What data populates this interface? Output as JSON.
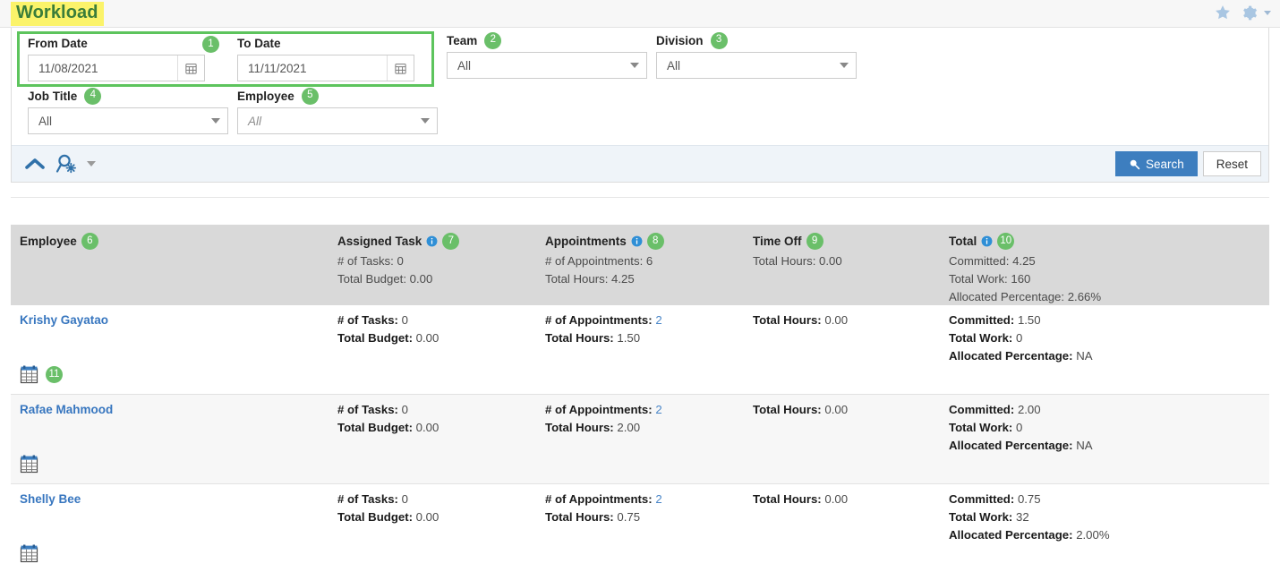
{
  "header": {
    "title": "Workload",
    "icons": [
      {
        "name": "favorite-star-icon"
      },
      {
        "name": "settings-gear-icon"
      }
    ]
  },
  "filters": {
    "from_date": {
      "label": "From Date",
      "badge": "1",
      "value": "11/08/2021",
      "icon": "calendar-icon"
    },
    "to_date": {
      "label": "To Date",
      "value": "11/11/2021",
      "icon": "calendar-icon"
    },
    "team": {
      "label": "Team",
      "badge": "2",
      "value": "All"
    },
    "division": {
      "label": "Division",
      "badge": "3",
      "value": "All"
    },
    "job_title": {
      "label": "Job Title",
      "badge": "4",
      "value": "All"
    },
    "employee": {
      "label": "Employee",
      "badge": "5",
      "value": "All",
      "is_placeholder": true
    }
  },
  "actions": {
    "collapse_icon": "chevron-up-icon",
    "advanced_search_icon": "search-settings-icon",
    "search_label": "Search",
    "reset_label": "Reset"
  },
  "grid": {
    "columns": [
      {
        "title": "Employee",
        "badge": "6",
        "info": false
      },
      {
        "title": "Assigned Task",
        "badge": "7",
        "info": true
      },
      {
        "title": "Appointments",
        "badge": "8",
        "info": true
      },
      {
        "title": "Time Off",
        "badge": "9",
        "info": false
      },
      {
        "title": "Total",
        "badge": "10",
        "info": true
      }
    ],
    "summary": {
      "task": [
        {
          "key": "# of Tasks:",
          "value": "0"
        },
        {
          "key": "Total Budget:",
          "value": "0.00"
        }
      ],
      "appointments": [
        {
          "key": "# of Appointments:",
          "value": "6"
        },
        {
          "key": "Total Hours:",
          "value": "4.25"
        }
      ],
      "time_off": [
        {
          "key": "Total Hours:",
          "value": "0.00"
        }
      ],
      "total": [
        {
          "key": "Committed:",
          "value": "4.25"
        },
        {
          "key": "Total Work:",
          "value": "160"
        },
        {
          "key": "Allocated Percentage:",
          "value": "2.66%"
        }
      ]
    },
    "row_calendar_icon": "calendar-icon",
    "row_calendar_badge": "11",
    "rows": [
      {
        "employee": "Krishy Gayatao",
        "task": [
          {
            "key": "# of Tasks:",
            "value": "0",
            "link": false
          },
          {
            "key": "Total Budget:",
            "value": "0.00",
            "link": false
          }
        ],
        "appointments": [
          {
            "key": "# of Appointments:",
            "value": "2",
            "link": true
          },
          {
            "key": "Total Hours:",
            "value": "1.50",
            "link": false
          }
        ],
        "time_off": [
          {
            "key": "Total Hours:",
            "value": "0.00",
            "link": false
          }
        ],
        "total": [
          {
            "key": "Committed:",
            "value": "1.50",
            "link": false
          },
          {
            "key": "Total Work:",
            "value": "0",
            "link": false
          },
          {
            "key": "Allocated Percentage:",
            "value": "NA",
            "link": false
          }
        ]
      },
      {
        "employee": "Rafae Mahmood",
        "task": [
          {
            "key": "# of Tasks:",
            "value": "0",
            "link": false
          },
          {
            "key": "Total Budget:",
            "value": "0.00",
            "link": false
          }
        ],
        "appointments": [
          {
            "key": "# of Appointments:",
            "value": "2",
            "link": true
          },
          {
            "key": "Total Hours:",
            "value": "2.00",
            "link": false
          }
        ],
        "time_off": [
          {
            "key": "Total Hours:",
            "value": "0.00",
            "link": false
          }
        ],
        "total": [
          {
            "key": "Committed:",
            "value": "2.00",
            "link": false
          },
          {
            "key": "Total Work:",
            "value": "0",
            "link": false
          },
          {
            "key": "Allocated Percentage:",
            "value": "NA",
            "link": false
          }
        ]
      },
      {
        "employee": "Shelly Bee",
        "task": [
          {
            "key": "# of Tasks:",
            "value": "0",
            "link": false
          },
          {
            "key": "Total Budget:",
            "value": "0.00",
            "link": false
          }
        ],
        "appointments": [
          {
            "key": "# of Appointments:",
            "value": "2",
            "link": true
          },
          {
            "key": "Total Hours:",
            "value": "0.75",
            "link": false
          }
        ],
        "time_off": [
          {
            "key": "Total Hours:",
            "value": "0.00",
            "link": false
          }
        ],
        "total": [
          {
            "key": "Committed:",
            "value": "0.75",
            "link": false
          },
          {
            "key": "Total Work:",
            "value": "32",
            "link": false
          },
          {
            "key": "Allocated Percentage:",
            "value": "2.00%",
            "link": false
          }
        ]
      }
    ]
  },
  "colors": {
    "badge_green": "#6abf69",
    "title_green": "#3a7d3a",
    "highlight_yellow": "#fbf36a",
    "link_blue": "#3776bf",
    "primary_blue": "#3d7ebf"
  }
}
